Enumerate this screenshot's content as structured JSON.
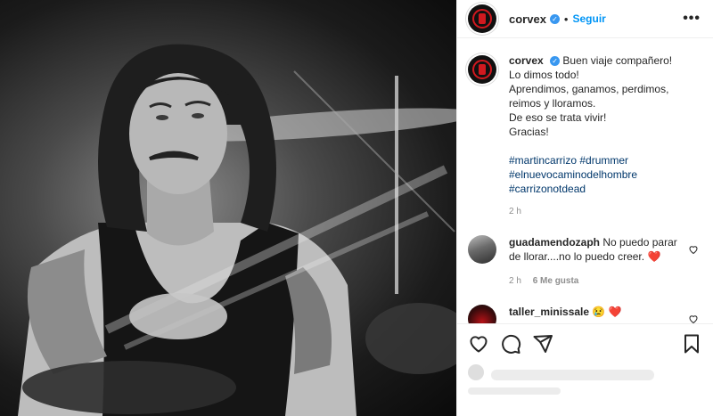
{
  "post": {
    "username": "corvex",
    "follow_label": "Seguir",
    "separator": "•",
    "more_label": "•••",
    "verified_glyph": "✓",
    "photo_description_icon": "drummer-photo",
    "caption": {
      "lines": [
        "Buen viaje compañero!",
        "Lo dimos todo!",
        "Aprendimos, ganamos, perdimos, reimos y lloramos.",
        "De eso se trata vivir!",
        "Gracias!"
      ],
      "hashtags": [
        "#martincarrizo #drummer",
        "#elnuevocaminodelhombre",
        "#carrizonotdead"
      ],
      "time": "2 h"
    },
    "comments": [
      {
        "username": "guadamendozaph",
        "text": "No puedo parar de llorar....no lo puedo creer.",
        "emoji": "❤️",
        "time": "2 h",
        "likes": "6 Me gusta"
      },
      {
        "username": "taller_minissale",
        "text": "",
        "emoji": "😢 ❤️"
      }
    ]
  },
  "colors": {
    "brand_red": "#d1191f",
    "follow_blue": "#0095f6",
    "hashtag": "#00376b",
    "muted": "#8e8e8e",
    "heart": "#d1191f"
  },
  "actions": {
    "like_icon": "heart-icon",
    "comment_icon": "comment-icon",
    "share_icon": "send-icon",
    "save_icon": "bookmark-icon"
  }
}
